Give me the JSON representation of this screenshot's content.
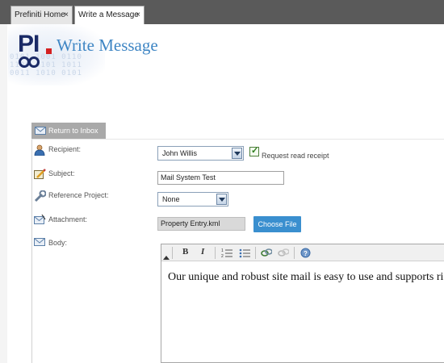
{
  "tabs": [
    {
      "label": "Prefiniti Home",
      "close": "×"
    },
    {
      "label": "Write a Message",
      "close": "×"
    }
  ],
  "header": {
    "logo_text": "PI",
    "title": "Write Message"
  },
  "return_button": {
    "label": "Return to Inbox",
    "icon": "envelope-icon"
  },
  "form": {
    "recipient": {
      "label": "Recipient:",
      "value": "John Willis",
      "icon": "person-icon"
    },
    "read_receipt": {
      "label": "Request read receipt",
      "checked": true
    },
    "subject": {
      "label": "Subject:",
      "value": "Mail System Test",
      "icon": "pencil-icon"
    },
    "reference_project": {
      "label": "Reference Project:",
      "value": "None",
      "icon": "wrench-icon"
    },
    "attachment": {
      "label": "Attachment:",
      "value": "Property Entry.kml",
      "icon": "envelope-attach-icon"
    },
    "choose_file": {
      "label": "Choose File"
    },
    "body": {
      "label": "Body:",
      "icon": "envelope-icon",
      "text": "Our unique and robust site mail is easy to use and supports ri"
    }
  },
  "editor_toolbar": {
    "bold": "B",
    "italic": "I",
    "ordered_list": "⋮≡",
    "unordered_list": "•≡",
    "link": "link",
    "unlink": "unlink",
    "help": "?"
  },
  "colors": {
    "title": "#3f86c4",
    "accent_button": "#3a8fcf",
    "tab_bar": "#5a5a5a"
  }
}
